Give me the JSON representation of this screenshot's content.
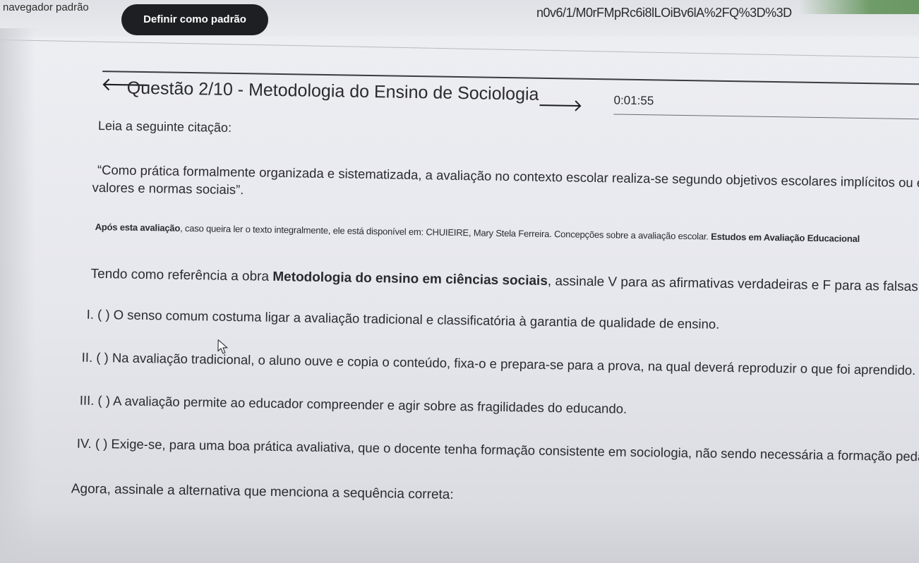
{
  "browser": {
    "default_browser_text": "navegador padrão",
    "set_default_label": "Definir como padrão",
    "url_fragment": "n0v6/1/M0rFMpRc6i8lLOiBv6lA%2FQ%3D%3D"
  },
  "question": {
    "title": "Questão 2/10 - Metodologia do Ensino de Sociologia",
    "timer": "0:01:55",
    "intro": "Leia a seguinte citação:",
    "quote_line1": "“Como prática formalmente organizada e sistematizada, a avaliação no contexto escolar realiza-se segundo objetivos escolares implícitos ou e",
    "quote_line2": "valores e normas sociais”.",
    "source_bold_start": "Após esta avaliação",
    "source_text": ", caso queira ler o texto integralmente, ele está disponível em: CHUIEIRE, Mary Stela Ferreira. Concepções sobre a avaliação escolar. ",
    "source_bold_end": "Estudos em Avaliação Educacional",
    "instruction_start": "Tendo como referência a obra ",
    "instruction_bold": "Metodologia do ensino em ciências sociais",
    "instruction_end": ", assinale V para as afirmativas verdadeiras e F para as falsas a respe",
    "statements": [
      "I. ( ) O senso comum costuma ligar a avaliação tradicional e classificatória à garantia de qualidade de ensino.",
      "II. ( ) Na avaliação tradicional, o aluno ouve e copia o conteúdo, fixa-o e prepara-se para a prova, na qual deverá reproduzir o que foi aprendido.",
      "III. ( ) A avaliação permite ao educador compreender e agir sobre as fragilidades do educando.",
      "IV. ( ) Exige-se, para uma boa prática avaliativa, que o docente tenha formação consistente em sociologia, não sendo necessária a formação pedagóg"
    ],
    "final_prompt": "Agora, assinale a alternativa que menciona a sequência correta:"
  },
  "icons": {
    "back": "arrow-left-icon",
    "forward": "arrow-right-icon",
    "cursor": "mouse-pointer-icon"
  },
  "colors": {
    "button_bg": "#1e1f22",
    "page_bg": "#e8e9ee",
    "text": "#2a2a30"
  }
}
